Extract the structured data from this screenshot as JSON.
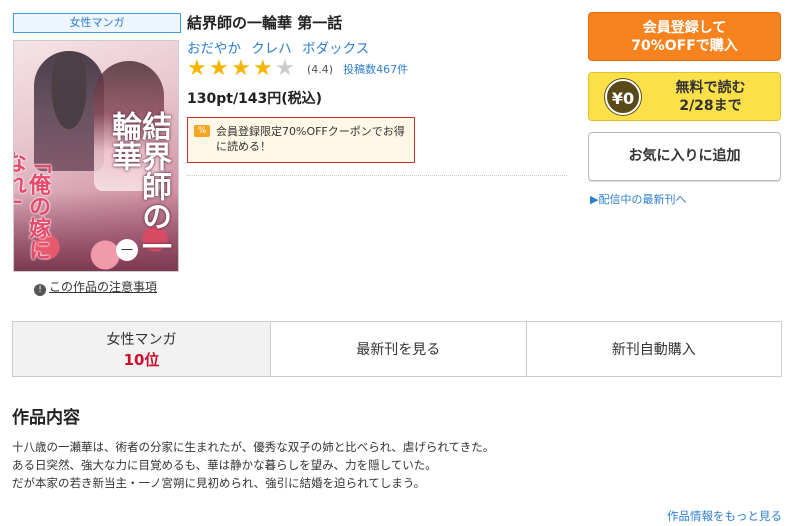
{
  "genre_tag": "女性マンガ",
  "cover": {
    "title_vertical": "結界師の一輪華",
    "subtitle_vertical": "「俺の嫁になれ」",
    "volume": "一"
  },
  "notice": {
    "icon": "info-icon",
    "text": "この作品の注意事項"
  },
  "book": {
    "title": "結界師の一輪華 第一話",
    "authors": [
      "おだやか",
      "クレハ",
      "ボダックス"
    ],
    "rating_value": 4,
    "rating_display": "(4.4)",
    "review_count": "投稿数467件",
    "price": "130pt/143円(税込)"
  },
  "coupon": {
    "icon": "ticket-icon",
    "text": "会員登録限定70%OFFクーポンでお得に読める！"
  },
  "actions": {
    "buy_line1": "会員登録して",
    "buy_line2": "70%OFFで購入",
    "free_badge": "¥0",
    "free_line1": "無料で読む",
    "free_line2": "2/28まで",
    "favorite": "お気に入りに追加",
    "latest_link": "▶配信中の最新刊へ"
  },
  "tabs": {
    "genre": "女性マンガ",
    "rank": "10位",
    "latest": "最新刊を見る",
    "auto_buy": "新刊自動購入"
  },
  "description": {
    "heading": "作品内容",
    "lines": [
      "十八歳の一瀬華は、術者の分家に生まれたが、優秀な双子の姉と比べられ、虐げられてきた。",
      "ある日突然、強大な力に目覚めるも、華は静かな暮らしを望み、力を隠していた。",
      "だが本家の若き新当主・一ノ宮朔に見初められ、強引に結婚を迫られてしまう。"
    ],
    "more": "作品情報をもっと見る"
  },
  "colors": {
    "accent_orange": "#f7831e",
    "free_yellow": "#fbe04a",
    "link_blue": "#2d7fd0",
    "rank_red": "#c8102e",
    "star_gold": "#f7b500"
  }
}
